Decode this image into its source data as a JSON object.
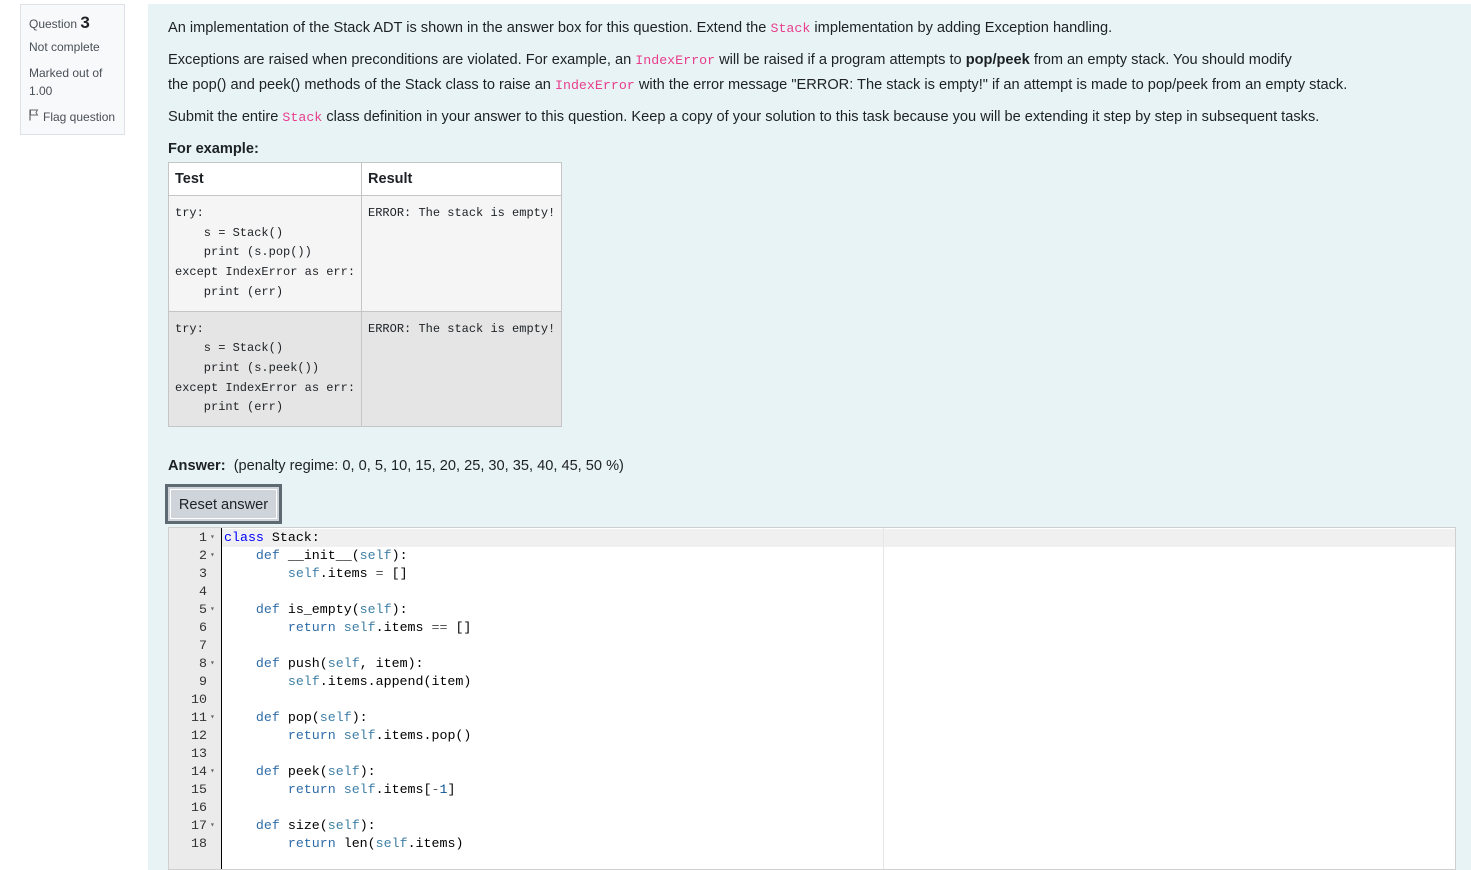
{
  "info": {
    "question_label": "Question",
    "question_number": "3",
    "status": "Not complete",
    "marked_out_of": "Marked out of 1.00",
    "flag_label": "Flag question"
  },
  "question": {
    "p1_before": "An implementation of the Stack ADT is shown in the answer box for this question. Extend the ",
    "p1_code": "Stack",
    "p1_after": " implementation by adding Exception handling.",
    "p2_a": "Exceptions are raised when preconditions are violated. For example, an ",
    "p2_code1": "IndexError",
    "p2_b": " will be raised if a program attempts to ",
    "p2_bold": "pop/peek",
    "p2_c": " from an empty stack. You should modify",
    "p3_a": "the ",
    "p3_pop": "pop()",
    "p3_b": " and ",
    "p3_peek": "peek()",
    "p3_c": " methods of the ",
    "p3_stack": "Stack",
    "p3_d": " class to raise an ",
    "p3_code2": "IndexError",
    "p3_e": " with the error message \"ERROR: The stack is empty!\" if an attempt is made to pop/peek from an empty stack.",
    "p4_a": "Submit the entire ",
    "p4_code": "Stack",
    "p4_b": " class definition in your answer to this question. Keep a copy of your solution to this task because you will be extending it step by step in subsequent tasks.",
    "for_example": "For example:"
  },
  "example_table": {
    "headers": [
      "Test",
      "Result"
    ],
    "rows": [
      {
        "test": "try:\n    s = Stack()\n    print (s.pop())\nexcept IndexError as err:\n    print (err)",
        "result": "ERROR: The stack is empty!"
      },
      {
        "test": "try:\n    s = Stack()\n    print (s.peek())\nexcept IndexError as err:\n    print (err)",
        "result": "ERROR: The stack is empty!"
      }
    ]
  },
  "answer": {
    "label": "Answer:",
    "penalty": "(penalty regime: 0, 0, 5, 10, 15, 20, 25, 30, 35, 40, 45, 50 %)",
    "reset_button": "Reset answer"
  },
  "editor": {
    "line_numbers": [
      "1",
      "2",
      "3",
      "4",
      "5",
      "6",
      "7",
      "8",
      "9",
      "10",
      "11",
      "12",
      "13",
      "14",
      "15",
      "16",
      "17",
      "18"
    ],
    "fold_markers": [
      "▾",
      "▾",
      "",
      "",
      "▾",
      "",
      "",
      "▾",
      "",
      "",
      "▾",
      "",
      "",
      "▾",
      "",
      "",
      "▾",
      ""
    ]
  },
  "colors": {
    "content_bg": "#e7f3f5",
    "inline_code": "#e83e8c",
    "keyword": "#0000ff"
  }
}
